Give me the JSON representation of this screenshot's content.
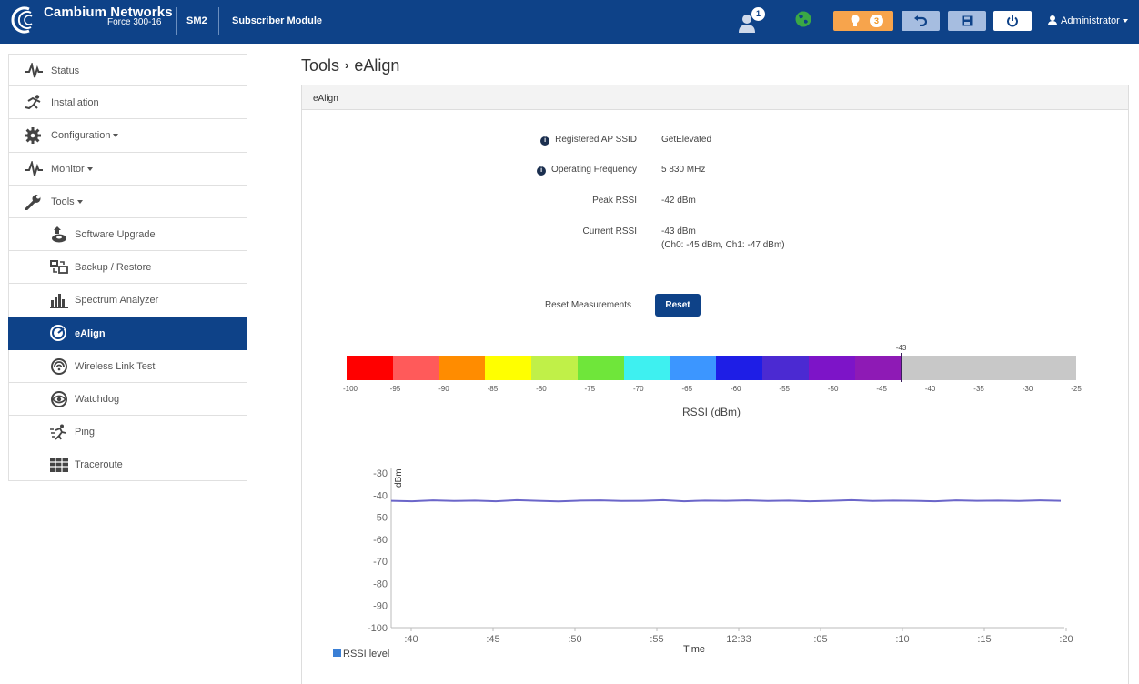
{
  "header": {
    "brand": "Cambium Networks",
    "model": "Force 300-16",
    "device_type": "SM2",
    "device_role": "Subscriber Module",
    "notifications_count": "1",
    "alerts_count": "3",
    "user": "Administrator",
    "colors": {
      "bar": "#0e4288",
      "alert": "#f7a44c",
      "globe": "#3aa845"
    }
  },
  "sidebar": {
    "items": [
      {
        "label": "Status",
        "icon": "pulse-icon",
        "dropdown": false
      },
      {
        "label": "Installation",
        "icon": "runner-icon",
        "dropdown": false
      },
      {
        "label": "Configuration",
        "icon": "gear-icon",
        "dropdown": true
      },
      {
        "label": "Monitor",
        "icon": "pulse-icon",
        "dropdown": true
      },
      {
        "label": "Tools",
        "icon": "wrench-icon",
        "dropdown": true
      }
    ],
    "sub_items": [
      {
        "label": "Software Upgrade",
        "icon": "upgrade-icon"
      },
      {
        "label": "Backup / Restore",
        "icon": "backup-icon"
      },
      {
        "label": "Spectrum Analyzer",
        "icon": "spectrum-icon"
      },
      {
        "label": "eAlign",
        "icon": "ealign-icon",
        "active": true
      },
      {
        "label": "Wireless Link Test",
        "icon": "link-test-icon"
      },
      {
        "label": "Watchdog",
        "icon": "eye-icon"
      },
      {
        "label": "Ping",
        "icon": "ping-icon"
      },
      {
        "label": "Traceroute",
        "icon": "traceroute-icon"
      }
    ]
  },
  "page": {
    "breadcrumb_parent": "Tools",
    "breadcrumb_current": "eAlign",
    "panel_title": "eAlign"
  },
  "info": {
    "ssid_label": "Registered AP SSID",
    "ssid_value": "GetElevated",
    "freq_label": "Operating Frequency",
    "freq_value": "5 830 MHz",
    "peak_label": "Peak RSSI",
    "peak_value": "-42 dBm",
    "current_label": "Current RSSI",
    "current_value": "-43 dBm",
    "current_detail": "(Ch0: -45 dBm, Ch1: -47 dBm)",
    "reset_label": "Reset Measurements",
    "reset_button": "Reset"
  },
  "rssi_bar": {
    "title": "RSSI (dBm)",
    "min": -100,
    "max": -25,
    "current": -43,
    "current_label": "-43",
    "ticks": [
      "-100",
      "-95",
      "-90",
      "-85",
      "-80",
      "-75",
      "-70",
      "-65",
      "-60",
      "-55",
      "-50",
      "-45",
      "-40",
      "-35",
      "-30",
      "-25"
    ],
    "segment_colors": [
      "#ff0000",
      "#ff5a5a",
      "#ff8c00",
      "#ffff00",
      "#c0f048",
      "#6fe63a",
      "#3ef0f0",
      "#3c96ff",
      "#1e1ee6",
      "#4b2ad2",
      "#7d14c8",
      "#8e1ab5"
    ],
    "empty_color": "#c8c8c8"
  },
  "chart_data": {
    "type": "line",
    "ylabel": "dBm",
    "xlabel": "Time",
    "ylim": [
      -100,
      -30
    ],
    "yticks": [
      "-30",
      "-40",
      "-50",
      "-60",
      "-70",
      "-80",
      "-90",
      "-100"
    ],
    "xticks": [
      ":40",
      ":45",
      ":50",
      ":55",
      "12:33",
      ":05",
      ":10",
      ":15",
      ":20"
    ],
    "series": [
      {
        "name": "RSSI level",
        "color": "#3a7fd5",
        "values": [
          -42.6,
          -42.8,
          -42.4,
          -42.7,
          -42.5,
          -42.8,
          -42.3,
          -42.6,
          -42.9,
          -42.5,
          -42.4,
          -42.7,
          -42.6,
          -42.3,
          -42.8,
          -42.5,
          -42.6,
          -42.4,
          -42.7,
          -42.5,
          -42.8,
          -42.6,
          -42.3,
          -42.7,
          -42.5,
          -42.6,
          -42.8,
          -42.4,
          -42.6,
          -42.5,
          -42.7,
          -42.4,
          -42.6
        ]
      }
    ],
    "legend": "bottom-left"
  }
}
